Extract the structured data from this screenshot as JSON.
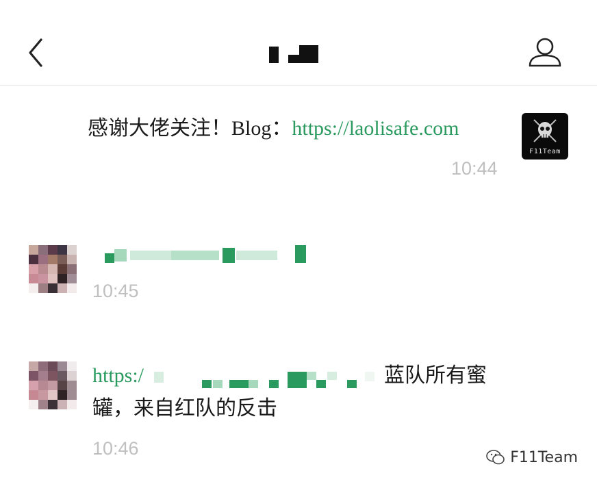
{
  "header": {
    "title": "",
    "back_icon": "chevron-left-icon",
    "profile_icon": "person-icon"
  },
  "messages": [
    {
      "sender": "self",
      "text": "感谢大佬关注！Blog：",
      "link": "https://laolisafe.com",
      "time": "10:44",
      "avatar_label": "F11Team"
    },
    {
      "sender": "other",
      "text": "",
      "time": "10:45"
    },
    {
      "sender": "other",
      "link_prefix": "https:/",
      "text_line1": "蓝队所有蜜",
      "text_line2": "罐，来自红队的反击",
      "time": "10:46"
    }
  ],
  "watermark": {
    "text": "F11Team",
    "icon": "wechat-icon"
  },
  "colors": {
    "link": "#2a9a5e",
    "timestamp": "#bfbfbf",
    "divider": "#e6e6e6"
  }
}
